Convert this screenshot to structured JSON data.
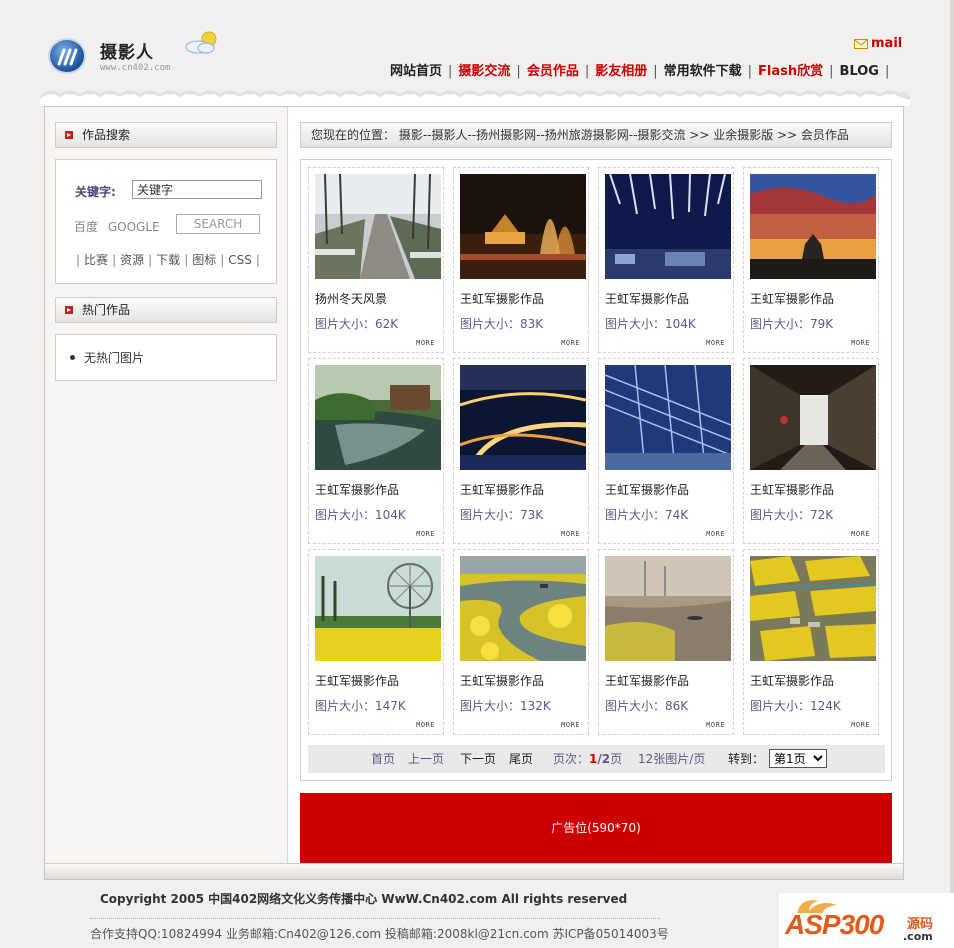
{
  "header": {
    "site_name": "摄影人",
    "site_url": "www.cn402.com",
    "mail_label": "mail",
    "nav": [
      {
        "label": "网站首页",
        "red": false
      },
      {
        "label": "摄影交流",
        "red": true
      },
      {
        "label": "会员作品",
        "red": true
      },
      {
        "label": "影友相册",
        "red": true
      },
      {
        "label": "常用软件下载",
        "red": false
      },
      {
        "label": "Flash欣赏",
        "red": true
      },
      {
        "label": "BLOG",
        "red": false
      }
    ]
  },
  "sidebar": {
    "search_title": "作品搜索",
    "keyword_label": "关键字:",
    "keyword_value": "关键字",
    "engine_baidu": "百度",
    "engine_google": "GOOGLE",
    "search_button": "SEARCH",
    "links": [
      "比赛",
      "资源",
      "下载",
      "图标",
      "CSS"
    ],
    "hot_title": "热门作品",
    "hot_empty": "无热门图片"
  },
  "breadcrumb": "您现在的位置： 摄影--摄影人--扬州摄影网--扬州旅游摄影网--摄影交流 >> 业余摄影版 >> 会员作品",
  "gallery": [
    {
      "caption": "扬州冬天风景",
      "size": "图片大小：62K",
      "more": "MORE",
      "scene": "snow-road"
    },
    {
      "caption": "王虹军摄影作品",
      "size": "图片大小：83K",
      "more": "MORE",
      "scene": "fountain-night"
    },
    {
      "caption": "王虹军摄影作品",
      "size": "图片大小：104K",
      "more": "MORE",
      "scene": "light-rays"
    },
    {
      "caption": "王虹军摄影作品",
      "size": "图片大小：79K",
      "more": "MORE",
      "scene": "sunset-pavilion"
    },
    {
      "caption": "王虹军摄影作品",
      "size": "图片大小：104K",
      "more": "MORE",
      "scene": "green-river"
    },
    {
      "caption": "王虹军摄影作品",
      "size": "图片大小：73K",
      "more": "MORE",
      "scene": "night-bridge"
    },
    {
      "caption": "王虹军摄影作品",
      "size": "图片大小：74K",
      "more": "MORE",
      "scene": "blue-structure"
    },
    {
      "caption": "王虹军摄影作品",
      "size": "图片大小：72K",
      "more": "MORE",
      "scene": "alley"
    },
    {
      "caption": "王虹军摄影作品",
      "size": "图片大小：147K",
      "more": "MORE",
      "scene": "windmill"
    },
    {
      "caption": "王虹军摄影作品",
      "size": "图片大小：132K",
      "more": "MORE",
      "scene": "canola-river"
    },
    {
      "caption": "王虹军摄影作品",
      "size": "图片大小：86K",
      "more": "MORE",
      "scene": "river-boat"
    },
    {
      "caption": "王虹军摄影作品",
      "size": "图片大小：124K",
      "more": "MORE",
      "scene": "fields"
    }
  ],
  "pager": {
    "first": "首页",
    "prev": "上一页",
    "next": "下一页",
    "last": "尾页",
    "page_label": "页次：",
    "current": "1",
    "total_sep": "/2",
    "page_suffix": "页",
    "per_page": "12张图片/页",
    "goto_label": "转到：",
    "goto_selected": "第1页"
  },
  "ad_text": "广告位(590*70)",
  "footer": {
    "copyright": "Copyright 2005 中国402网络文化义务传播中心  WwW.Cn402.com All rights reserved",
    "contact": "合作支持QQ:10824994  业务邮箱:Cn402@126.com  投稿邮箱:2008kl@21cn.com 苏ICP备05014003号"
  },
  "watermark": {
    "brand": "ASP300",
    "suffix": "源码",
    "domain": ".com"
  }
}
